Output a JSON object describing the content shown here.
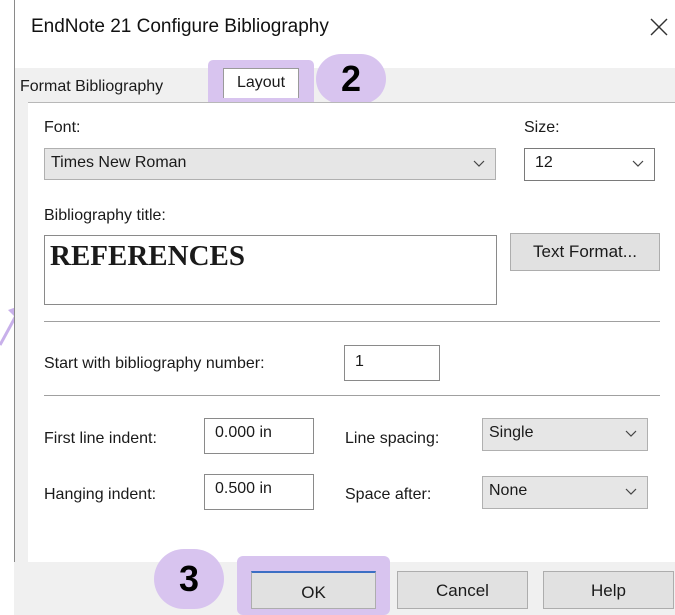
{
  "window": {
    "title": "EndNote 21 Configure Bibliography"
  },
  "tabs": [
    {
      "label": "Format Bibliography"
    },
    {
      "label": "Layout"
    }
  ],
  "font": {
    "label": "Font:",
    "value": "Times New Roman"
  },
  "size": {
    "label": "Size:",
    "value": "12"
  },
  "bibliography_title": {
    "label": "Bibliography title:",
    "value": "REFERENCES"
  },
  "text_format_button": "Text Format...",
  "start_number": {
    "label": "Start with bibliography number:",
    "value": "1"
  },
  "first_line_indent": {
    "label": "First line indent:",
    "value": "0.000 in"
  },
  "hanging_indent": {
    "label": "Hanging indent:",
    "value": "0.500 in"
  },
  "line_spacing": {
    "label": "Line spacing:",
    "value": "Single"
  },
  "space_after": {
    "label": "Space after:",
    "value": "None"
  },
  "buttons": {
    "ok": "OK",
    "cancel": "Cancel",
    "help": "Help"
  },
  "annotations": {
    "step2": "2",
    "step3": "3"
  },
  "colors": {
    "highlight": "#d8c4ef",
    "ok_focus": "#3c6fc4"
  }
}
